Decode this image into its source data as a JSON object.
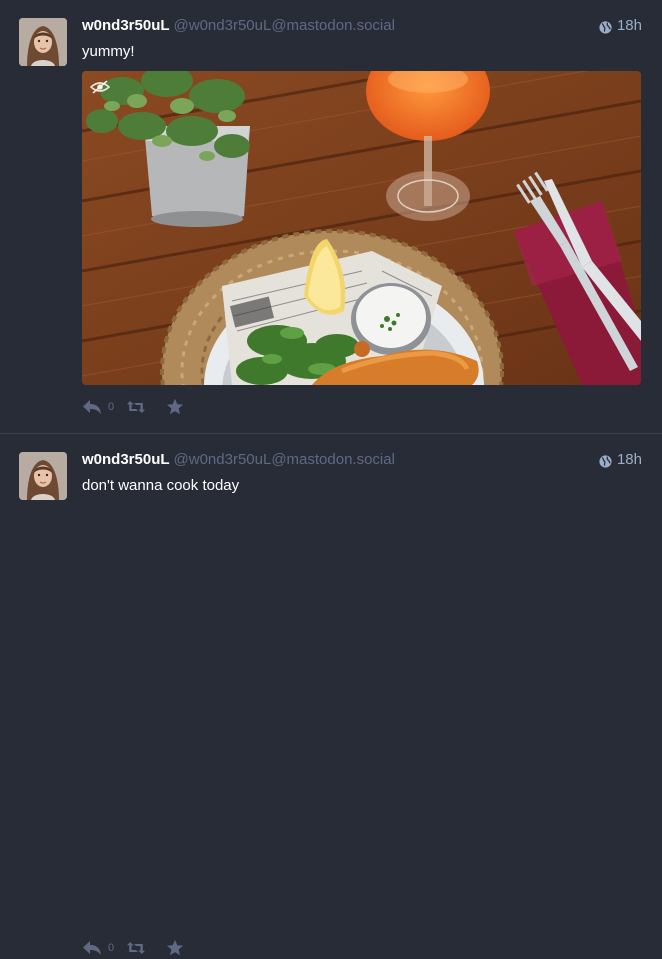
{
  "statuses": [
    {
      "display_name": "w0nd3r50uL",
      "acct": "@w0nd3r50uL@mastodon.social",
      "time": "18h",
      "content": "yummy!",
      "reply_count": "0",
      "has_media": true,
      "visibility_icon": "globe-icon",
      "media_icon": "eye-icon"
    },
    {
      "display_name": "w0nd3r50uL",
      "acct": "@w0nd3r50uL@mastodon.social",
      "time": "18h",
      "content": "don't wanna cook today",
      "reply_count": "0",
      "has_media": false,
      "visibility_icon": "globe-icon"
    }
  ],
  "colors": {
    "background": "#282c37",
    "divider": "#393f4f",
    "muted": "#606984",
    "time": "#9baec8",
    "text": "#ffffff"
  }
}
